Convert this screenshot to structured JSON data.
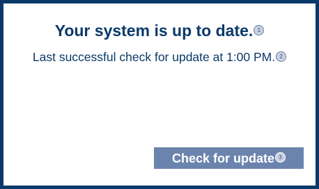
{
  "status": {
    "title": "Your system is up to date.",
    "title_marker": "1",
    "detail": "Last successful check for update at 1:00 PM.",
    "detail_marker": "2"
  },
  "actions": {
    "check_label": "Check for update",
    "check_marker": "3"
  },
  "colors": {
    "frame": "#0b3a69",
    "text": "#0b3a69",
    "button_bg": "#6b84ad",
    "button_text": "#ffffff",
    "marker_bg": "#c9d2e2"
  }
}
